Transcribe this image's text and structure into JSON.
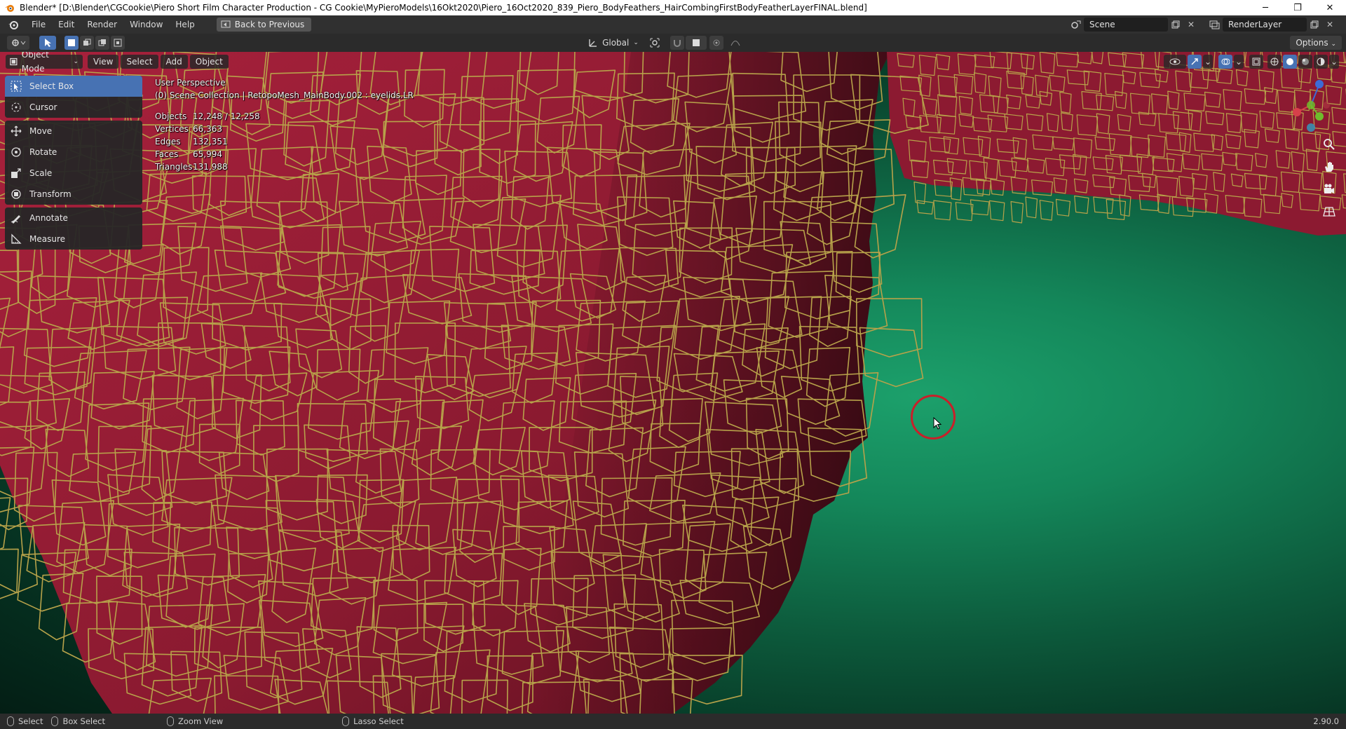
{
  "window": {
    "title": "Blender* [D:\\Blender\\CGCookie\\Piero Short Film Character Production - CG Cookie\\MyPieroModels\\16Okt2020\\Piero_16Oct2020_839_Piero_BodyFeathers_HairCombingFirstBodyFeatherLayerFINAL.blend]",
    "minimize": "─",
    "maximize": "❐",
    "close": "✕"
  },
  "menu": {
    "items": [
      "File",
      "Edit",
      "Render",
      "Window",
      "Help"
    ],
    "back_to_previous": "Back to Previous"
  },
  "scene": {
    "name": "Scene",
    "render_layer": "RenderLayer"
  },
  "tool_header": {
    "orientation": "Global",
    "options": "Options"
  },
  "viewport_header": {
    "mode": "Object Mode",
    "menus": [
      "View",
      "Select",
      "Add",
      "Object"
    ]
  },
  "toolbar": {
    "groups": [
      [
        {
          "label": "Select Box",
          "icon": "select-box-icon",
          "active": true
        },
        {
          "label": "Cursor",
          "icon": "cursor-icon",
          "active": false
        }
      ],
      [
        {
          "label": "Move",
          "icon": "move-icon",
          "active": false
        },
        {
          "label": "Rotate",
          "icon": "rotate-icon",
          "active": false
        },
        {
          "label": "Scale",
          "icon": "scale-icon",
          "active": false
        },
        {
          "label": "Transform",
          "icon": "transform-icon",
          "active": false
        }
      ],
      [
        {
          "label": "Annotate",
          "icon": "annotate-icon",
          "active": false
        },
        {
          "label": "Measure",
          "icon": "measure-icon",
          "active": false
        }
      ]
    ]
  },
  "overlay": {
    "perspective": "User Perspective",
    "collection": "(0) Scene Collection | RetopoMesh_MainBody.002 : eyelids.LR",
    "stats": [
      {
        "label": "Objects",
        "value": "12,248 / 12,258"
      },
      {
        "label": "Vertices",
        "value": "66,363"
      },
      {
        "label": "Edges",
        "value": "132,351"
      },
      {
        "label": "Faces",
        "value": "65,994"
      },
      {
        "label": "Triangles",
        "value": "131,988"
      }
    ]
  },
  "gizmo": {
    "z": "Z",
    "y": "Y",
    "x": "X"
  },
  "statusbar": {
    "select": "Select",
    "box_select": "Box Select",
    "zoom_view": "Zoom View",
    "lasso_select": "Lasso Select",
    "version": "2.90.0"
  },
  "colors": {
    "accent": "#4772b3",
    "feather": "#a0203a",
    "feather_edge": "#b8a34a",
    "background_green": "#1ca06b",
    "cursor_ring": "#c8202a"
  }
}
